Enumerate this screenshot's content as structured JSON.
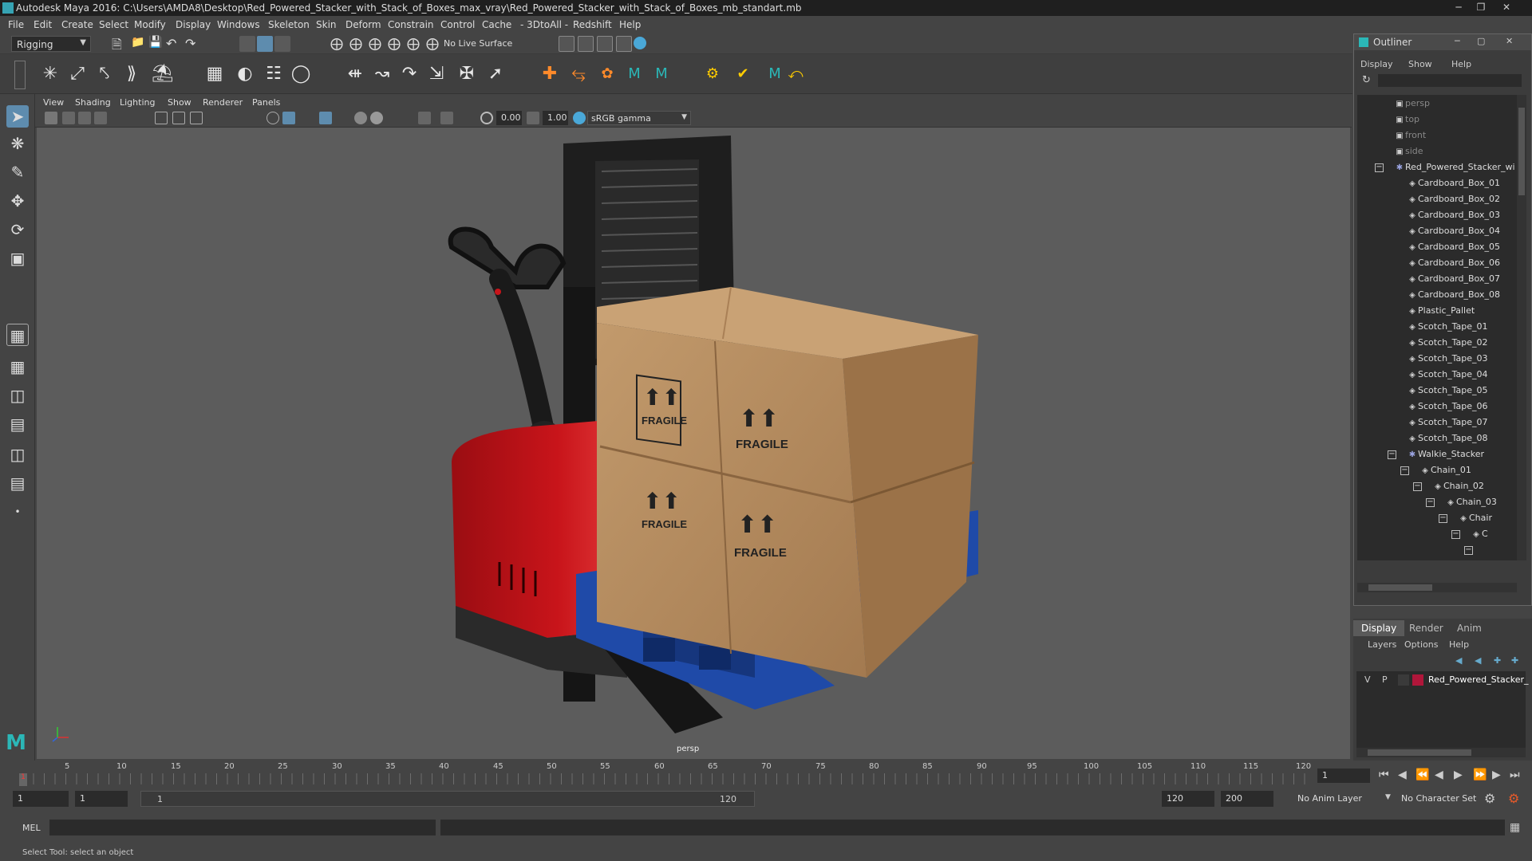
{
  "window": {
    "title": "Autodesk Maya 2016: C:\\Users\\AMDA8\\Desktop\\Red_Powered_Stacker_with_Stack_of_Boxes_max_vray\\Red_Powered_Stacker_with_Stack_of_Boxes_mb_standart.mb"
  },
  "menubar": [
    "File",
    "Edit",
    "Create",
    "Select",
    "Modify",
    "Display",
    "Windows",
    "Skeleton",
    "Skin",
    "Deform",
    "Constrain",
    "Control",
    "Cache",
    "- 3DtoAll -",
    "Redshift",
    "Help"
  ],
  "toolbar": {
    "menuset": "Rigging",
    "live_surface": "No Live Surface"
  },
  "viewport": {
    "menus": [
      "View",
      "Shading",
      "Lighting",
      "Show",
      "Renderer",
      "Panels"
    ],
    "exposure": "0.00",
    "gamma": "1.00",
    "color_space": "sRGB gamma",
    "camera_label": "persp",
    "box_label": "FRAGILE"
  },
  "timeline": {
    "ticks": [
      "5",
      "10",
      "15",
      "20",
      "25",
      "30",
      "35",
      "40",
      "45",
      "50",
      "55",
      "60",
      "65",
      "70",
      "75",
      "80",
      "85",
      "90",
      "95",
      "100",
      "105",
      "110",
      "115",
      "120"
    ],
    "start_marker": "1",
    "current_frame": "1"
  },
  "range": {
    "start": "1",
    "playback_start": "1",
    "slider_start": "1",
    "slider_end": "120",
    "playback_end": "120",
    "end": "200",
    "anim_layer": "No Anim Layer",
    "char_set": "No Character Set"
  },
  "mel": {
    "label": "MEL"
  },
  "helpline": "Select Tool: select an object",
  "outliner": {
    "title": "Outliner",
    "menus": [
      "Display",
      "Show",
      "Help"
    ],
    "cameras": [
      "persp",
      "top",
      "front",
      "side"
    ],
    "root": "Red_Powered_Stacker_wi",
    "children": [
      "Cardboard_Box_01",
      "Cardboard_Box_02",
      "Cardboard_Box_03",
      "Cardboard_Box_04",
      "Cardboard_Box_05",
      "Cardboard_Box_06",
      "Cardboard_Box_07",
      "Cardboard_Box_08",
      "Plastic_Pallet",
      "Scotch_Tape_01",
      "Scotch_Tape_02",
      "Scotch_Tape_03",
      "Scotch_Tape_04",
      "Scotch_Tape_05",
      "Scotch_Tape_06",
      "Scotch_Tape_07",
      "Scotch_Tape_08"
    ],
    "walkie": "Walkie_Stacker",
    "chains": [
      "Chain_01",
      "Chain_02",
      "Chain_03",
      "Chair",
      "C"
    ]
  },
  "layer_editor": {
    "tabs": [
      "Display",
      "Render",
      "Anim"
    ],
    "menus": [
      "Layers",
      "Options",
      "Help"
    ],
    "layer": {
      "v": "V",
      "p": "P",
      "name": "Red_Powered_Stacker_",
      "color": "#b0163a"
    }
  },
  "colors": {
    "stacker_red": "#c8141a",
    "pallet_blue": "#1f4aa8",
    "box_brown": "#b38a5e",
    "accent": "#4aa8d8"
  }
}
